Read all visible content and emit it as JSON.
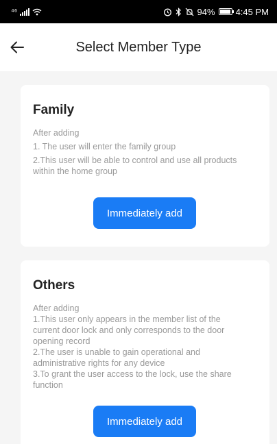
{
  "status_bar": {
    "network": "⁴⁶",
    "icons": [
      "alarm-icon",
      "bluetooth-icon",
      "mute-icon"
    ],
    "battery_percent": "94%",
    "battery_level": 0.94,
    "time": "4:45 PM"
  },
  "header": {
    "title": "Select Member Type",
    "back_icon": "arrow-left-icon"
  },
  "family": {
    "title": "Family",
    "after": "After adding",
    "line1": "1. The user will enter the family group",
    "line2a": "2.This user will be able to control and use all products",
    "line2b": "within the home group",
    "button": "Immediately add"
  },
  "others": {
    "title": "Others",
    "after": "After adding",
    "line1a": "1.This user only appears in the member list of the",
    "line1b": "current door lock and only corresponds to the door",
    "line1c": "opening record",
    "line2a": "2.The user is unable to gain operational and",
    "line2b": "administrative rights for any device",
    "line3a": "3.To grant the user access to the lock, use the share",
    "line3b": "function",
    "button": "Immediately add"
  },
  "colors": {
    "accent": "#1a7cf5",
    "background": "#f5f5f5",
    "card": "#ffffff",
    "muted_text": "#999999"
  }
}
